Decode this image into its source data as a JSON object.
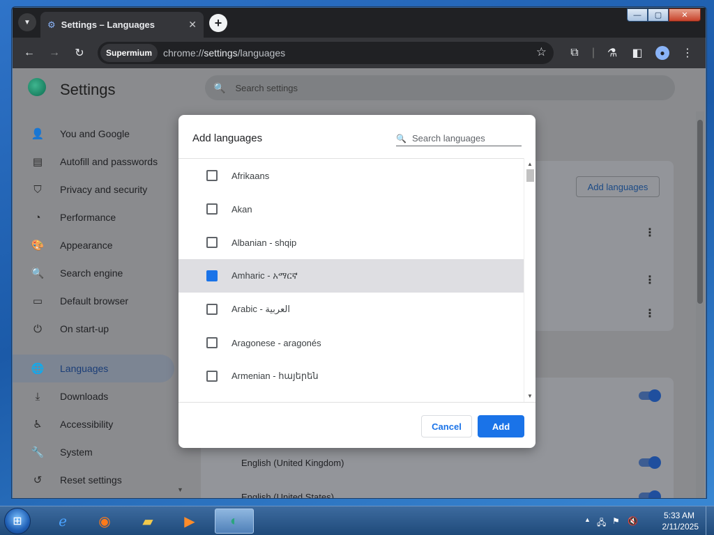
{
  "window": {
    "controls": {
      "minimize": "—",
      "maximize": "▢",
      "close": "✕"
    }
  },
  "tab": {
    "title": "Settings – Languages",
    "close": "✕",
    "new_tab": "+"
  },
  "toolbar": {
    "back": "←",
    "forward": "→",
    "reload": "↻",
    "omni_chip": "Supermium",
    "url_prefix": "chrome://",
    "url_host": "settings",
    "url_path": "/languages",
    "bookmark": "☆"
  },
  "settings": {
    "title": "Settings",
    "search_placeholder": "Search settings",
    "nav": [
      {
        "label": "You and Google",
        "icon": "👤"
      },
      {
        "label": "Autofill and passwords",
        "icon": "▤"
      },
      {
        "label": "Privacy and security",
        "icon": "⛉"
      },
      {
        "label": "Performance",
        "icon": "◔"
      },
      {
        "label": "Appearance",
        "icon": "🎨"
      },
      {
        "label": "Search engine",
        "icon": "🔍"
      },
      {
        "label": "Default browser",
        "icon": "▭"
      },
      {
        "label": "On start-up",
        "icon": "⏻"
      },
      {
        "label": "Languages",
        "icon": "🌐"
      },
      {
        "label": "Downloads",
        "icon": "⤓"
      },
      {
        "label": "Accessibility",
        "icon": "♿"
      },
      {
        "label": "System",
        "icon": "🔧"
      },
      {
        "label": "Reset settings",
        "icon": "↺"
      }
    ],
    "bg_add_languages": "Add languages",
    "bg_languages": [
      "English (United Kingdom)",
      "English (United States)"
    ]
  },
  "dialog": {
    "title": "Add languages",
    "search_placeholder": "Search languages",
    "languages": [
      {
        "label": "Afrikaans",
        "checked": false
      },
      {
        "label": "Akan",
        "checked": false
      },
      {
        "label": "Albanian - shqip",
        "checked": false
      },
      {
        "label": "Amharic - አማርኛ",
        "checked": true
      },
      {
        "label": "Arabic - العربية",
        "checked": false
      },
      {
        "label": "Aragonese - aragonés",
        "checked": false
      },
      {
        "label": "Armenian - հայերեն",
        "checked": false
      }
    ],
    "cancel_label": "Cancel",
    "add_label": "Add"
  },
  "taskbar": {
    "clock_time": "5:33 AM",
    "clock_date": "2/11/2025"
  }
}
